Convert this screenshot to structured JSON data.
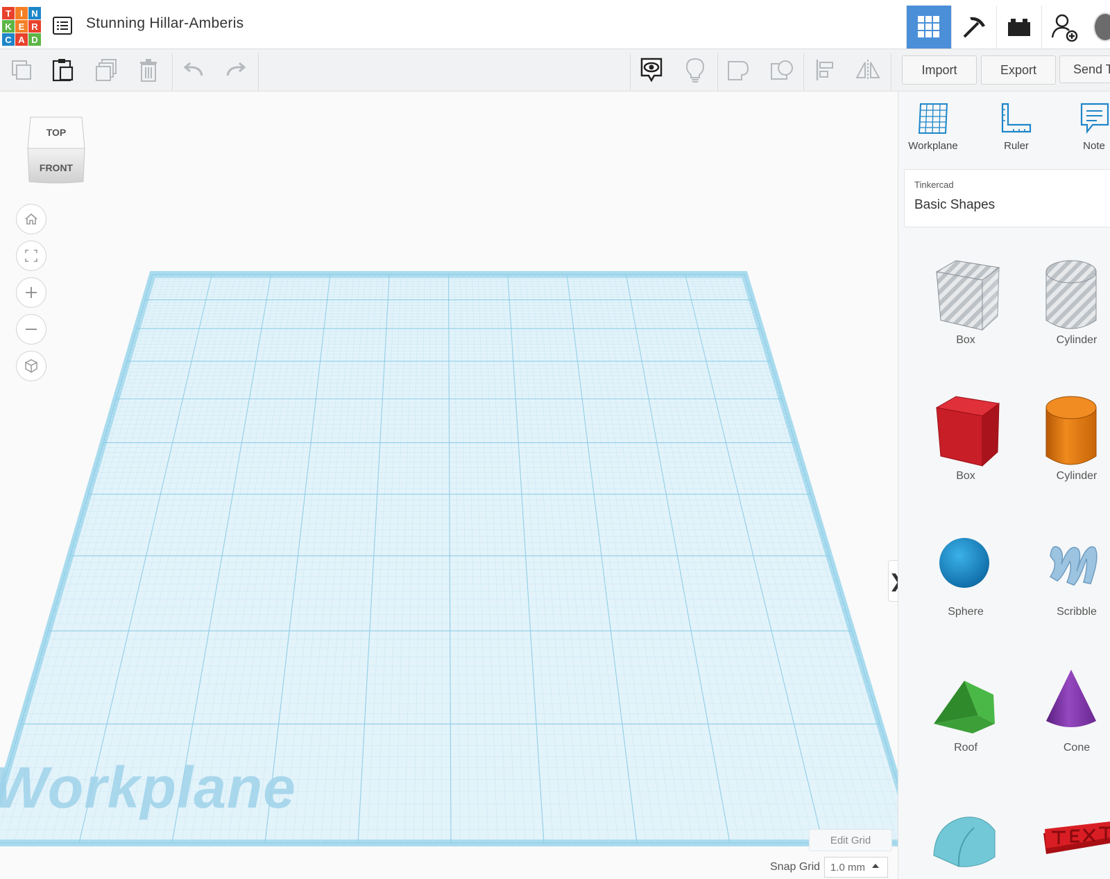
{
  "header": {
    "logo_letters": [
      "T",
      "I",
      "N",
      "K",
      "E",
      "R",
      "C",
      "A",
      "D"
    ],
    "logo_colors": [
      "#e8412c",
      "#f57f25",
      "#1d86c9",
      "#5cb546",
      "#f57f25",
      "#e8412c",
      "#1d86c9",
      "#e8412c",
      "#5cb546"
    ],
    "design_title": "Stunning Hillar-Amberis",
    "right_buttons": [
      "3d-design-grid-icon",
      "pickaxe-icon",
      "brick-icon",
      "add-user-icon"
    ],
    "accent_color": "#4a8fd8"
  },
  "toolbar": {
    "left_tools": [
      "copy-icon",
      "paste-icon",
      "duplicate-icon",
      "delete-icon",
      "undo-icon",
      "redo-icon"
    ],
    "view_tools": [
      "notes-visibility-icon",
      "show-all-icon",
      "group-icon",
      "ungroup-icon",
      "align-icon",
      "mirror-icon"
    ],
    "import_label": "Import",
    "export_label": "Export",
    "send_to_label": "Send T"
  },
  "canvas": {
    "viewcube_top": "TOP",
    "viewcube_front": "FRONT",
    "nav_buttons": [
      "home-icon",
      "fit-view-icon",
      "zoom-in-icon",
      "zoom-out-icon",
      "perspective-icon"
    ],
    "workplane_watermark": "Workplane",
    "edit_grid_label": "Edit Grid",
    "snap_grid_label": "Snap Grid",
    "snap_grid_value": "1.0 mm",
    "collapse_glyph": "❯"
  },
  "panel": {
    "tools": [
      {
        "label": "Workplane",
        "icon": "workplane-icon"
      },
      {
        "label": "Ruler",
        "icon": "ruler-icon"
      },
      {
        "label": "Note",
        "icon": "note-icon"
      }
    ],
    "library_source": "Tinkercad",
    "library_name": "Basic Shapes",
    "shapes": [
      {
        "label": "Box",
        "icon": "box-hole-icon",
        "color": "#b9bec4"
      },
      {
        "label": "Cylinder",
        "icon": "cylinder-hole-icon",
        "color": "#b9bec4"
      },
      {
        "label": "Box",
        "icon": "box-icon",
        "color": "#d0202a"
      },
      {
        "label": "Cylinder",
        "icon": "cylinder-icon",
        "color": "#e2760f"
      },
      {
        "label": "Sphere",
        "icon": "sphere-icon",
        "color": "#1a8ccf"
      },
      {
        "label": "Scribble",
        "icon": "scribble-icon",
        "color": "#8fb8d8"
      },
      {
        "label": "Roof",
        "icon": "roof-icon",
        "color": "#3ea13b"
      },
      {
        "label": "Cone",
        "icon": "cone-icon",
        "color": "#7a35a0"
      },
      {
        "label": "",
        "icon": "round-roof-icon",
        "color": "#6ec6d3"
      },
      {
        "label": "",
        "icon": "text-icon",
        "color": "#c8171d"
      }
    ]
  }
}
